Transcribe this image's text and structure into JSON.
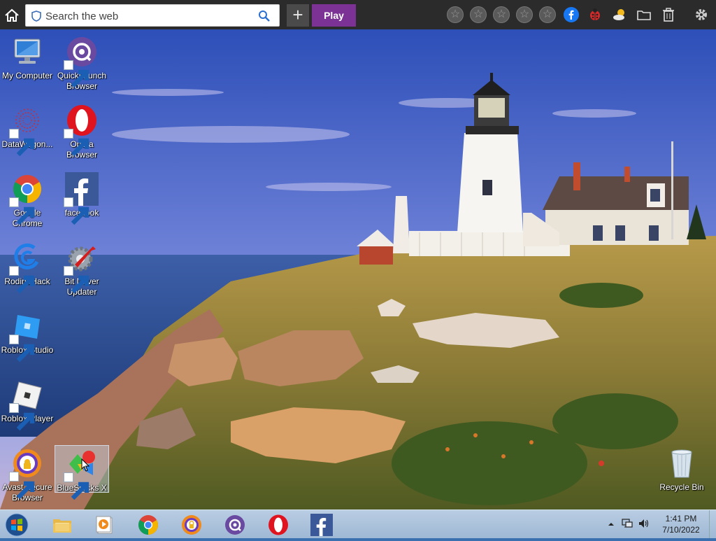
{
  "toolbar": {
    "search_placeholder": "Search the web",
    "play_label": "Play",
    "plus_label": "+",
    "star_glyph": "☆",
    "accent": "#7b3294"
  },
  "desktop_icons": [
    {
      "label": "My Computer",
      "icon": "my-computer-icon"
    },
    {
      "label": "QuickLaunch Browser",
      "icon": "quicklaunch-browser-icon"
    },
    {
      "label": "DataWagon...",
      "icon": "datawagon-icon"
    },
    {
      "label": "Opera Browser",
      "icon": "opera-icon"
    },
    {
      "label": "Google Chrome",
      "icon": "chrome-icon"
    },
    {
      "label": "facebook",
      "icon": "facebook-icon"
    },
    {
      "label": "RodinaHack",
      "icon": "rodinahack-icon"
    },
    {
      "label": "Bit Driver Updater",
      "icon": "bit-driver-updater-icon"
    },
    {
      "label": "Roblox Studio",
      "icon": "roblox-studio-icon"
    },
    {
      "label": "Roblox Player",
      "icon": "roblox-player-icon"
    },
    {
      "label": "Avast Secure Browser",
      "icon": "avast-browser-icon"
    },
    {
      "label": "BlueStacks X",
      "icon": "bluestacks-icon"
    },
    {
      "label": "Recycle Bin",
      "icon": "recycle-bin-icon"
    }
  ],
  "taskbar": {
    "time": "1:41 PM",
    "date": "7/10/2022",
    "pinned": [
      "file-explorer-icon",
      "media-player-icon",
      "chrome-icon",
      "avast-browser-icon",
      "quicklaunch-browser-icon",
      "opera-icon",
      "facebook-icon"
    ]
  }
}
